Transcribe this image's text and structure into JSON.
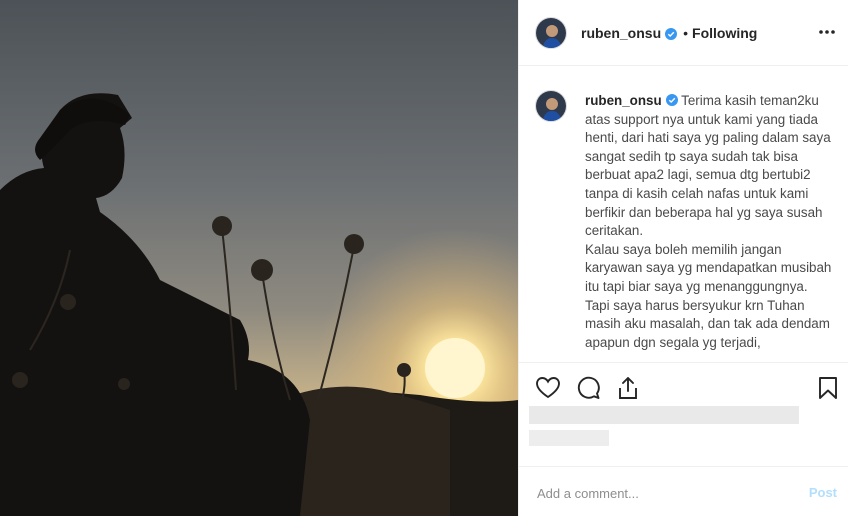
{
  "post": {
    "username": "ruben_onsu",
    "follow_state": "Following",
    "separator": "•",
    "caption": "Terima kasih teman2ku atas support nya untuk kami yang tiada henti, dari hati saya yg paling dalam saya sangat sedih tp saya sudah tak bisa berbuat apa2 lagi, semua dtg bertubi2 tanpa di kasih celah nafas untuk kami berfikir dan beberapa hal yg saya susah ceritakan.\nKalau saya boleh memilih jangan karyawan saya yg mendapatkan musibah itu tapi biar saya yg menanggungnya.\nTapi saya harus bersyukur krn Tuhan masih aku masalah, dan tak ada dendam apapun dgn segala yg terjadi,"
  },
  "icons": {
    "verified": "verified-badge-icon",
    "more": "more-options-icon",
    "like": "heart-icon",
    "comment": "comment-icon",
    "share": "share-icon",
    "save": "bookmark-icon"
  },
  "comment_box": {
    "placeholder": "Add a comment...",
    "post_label": "Post"
  },
  "colors": {
    "verified": "#3897f0",
    "post_disabled": "#b2dffc",
    "border": "#efefef"
  }
}
